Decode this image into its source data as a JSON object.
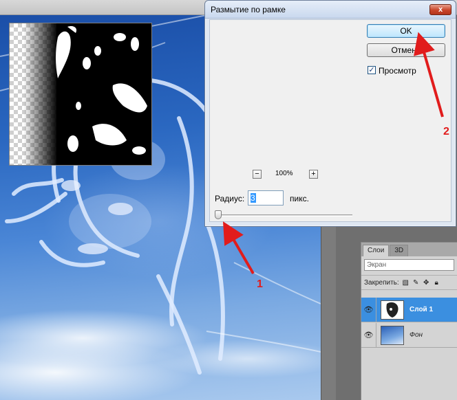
{
  "dialog": {
    "title": "Размытие по рамке",
    "close_glyph": "x",
    "ok_label": "OK",
    "cancel_label": "Отмена",
    "preview_checkbox_label": "Просмотр",
    "preview_checked": true,
    "zoom_minus": "−",
    "zoom_plus": "+",
    "zoom_level": "100%",
    "radius_label": "Радиус:",
    "radius_value": "3",
    "radius_unit": "пикс.",
    "slider_value": 3
  },
  "layers_panel": {
    "tabs": [
      "Слои",
      "3D"
    ],
    "active_tab": "Слои",
    "blend_mode": "Экран",
    "lock_label": "Закрепить:",
    "layers": [
      {
        "name": "Слой 1",
        "visible": true,
        "selected": true
      },
      {
        "name": "Фон",
        "visible": true,
        "selected": false
      }
    ]
  },
  "annotations": {
    "step1": "1",
    "step2": "2",
    "color": "#e11c1c"
  },
  "colors": {
    "selection": "#3b8fe0",
    "sky": "#2a67c0"
  }
}
